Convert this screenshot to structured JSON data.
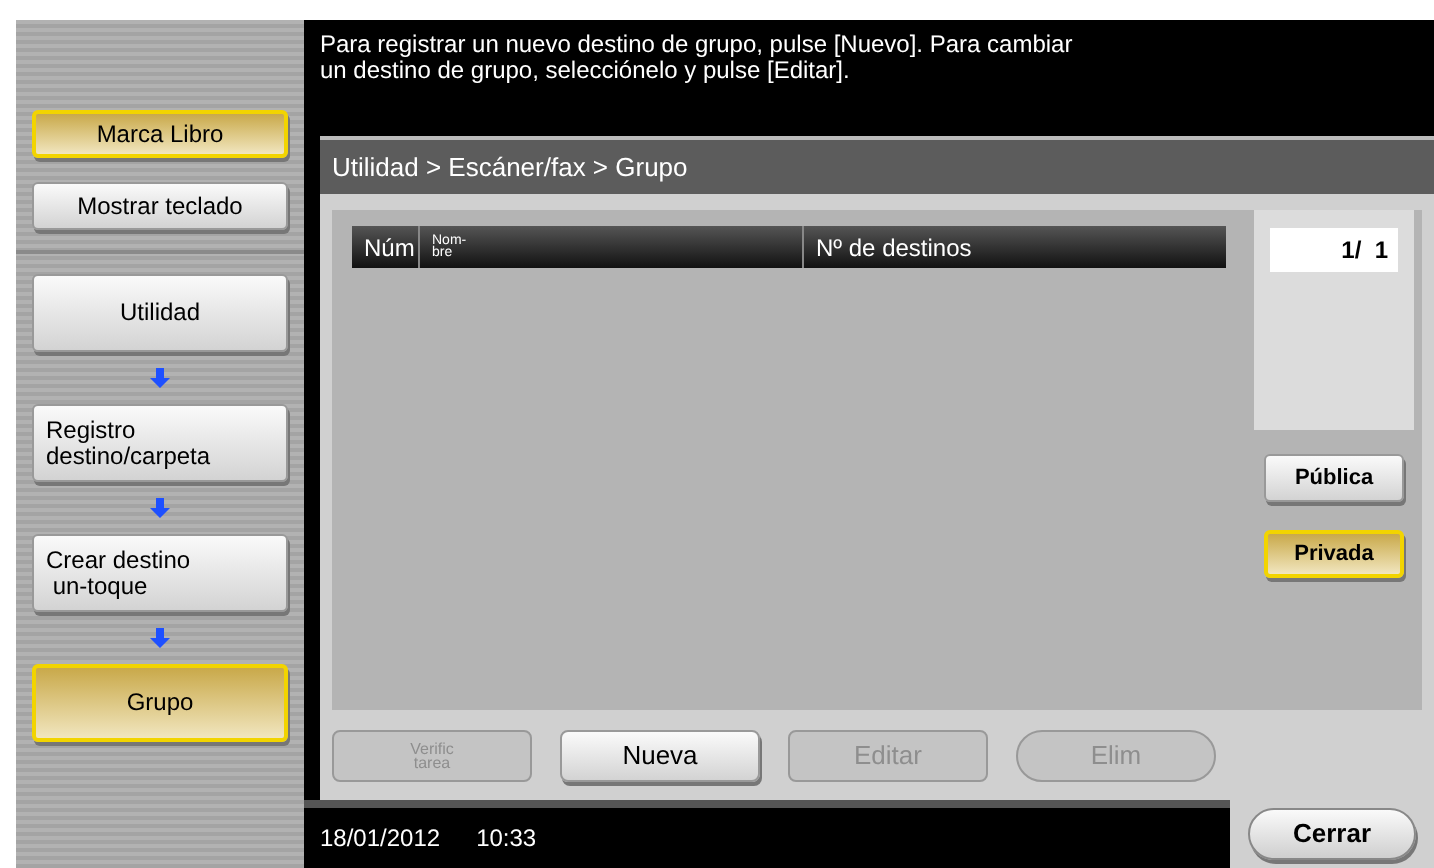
{
  "sidebar": {
    "top_buttons": [
      {
        "label": "Marca Libro",
        "selected": true
      },
      {
        "label": "Mostrar teclado",
        "selected": false
      }
    ],
    "steps": [
      {
        "label": "Utilidad",
        "selected": false
      },
      {
        "label": "Registro\ndestino/carpeta",
        "selected": false
      },
      {
        "label": "Crear destino\n un-toque",
        "selected": false
      },
      {
        "label": "Grupo",
        "selected": true
      }
    ]
  },
  "message": "Para registrar un nuevo destino de grupo, pulse [Nuevo]. Para cambiar\nun destino de grupo, selecciónelo y pulse [Editar].",
  "breadcrumb": "Utilidad > Escáner/fax > Grupo",
  "table": {
    "columns": [
      "Núm",
      "Nom-\nbre",
      "Nº de destinos"
    ]
  },
  "page_indicator": "1/  1",
  "filters": [
    {
      "label": "Pública",
      "selected": false
    },
    {
      "label": "Privada",
      "selected": true
    }
  ],
  "actions": [
    {
      "label": "Verific\ntarea",
      "kind": "small",
      "disabled": true
    },
    {
      "label": "Nueva",
      "kind": "corner",
      "disabled": false
    },
    {
      "label": "Editar",
      "kind": "corner",
      "disabled": true
    },
    {
      "label": "Elim",
      "kind": "pill",
      "disabled": true
    }
  ],
  "status_bar": {
    "date": "18/01/2012",
    "time": "10:33"
  },
  "close_button": "Cerrar"
}
